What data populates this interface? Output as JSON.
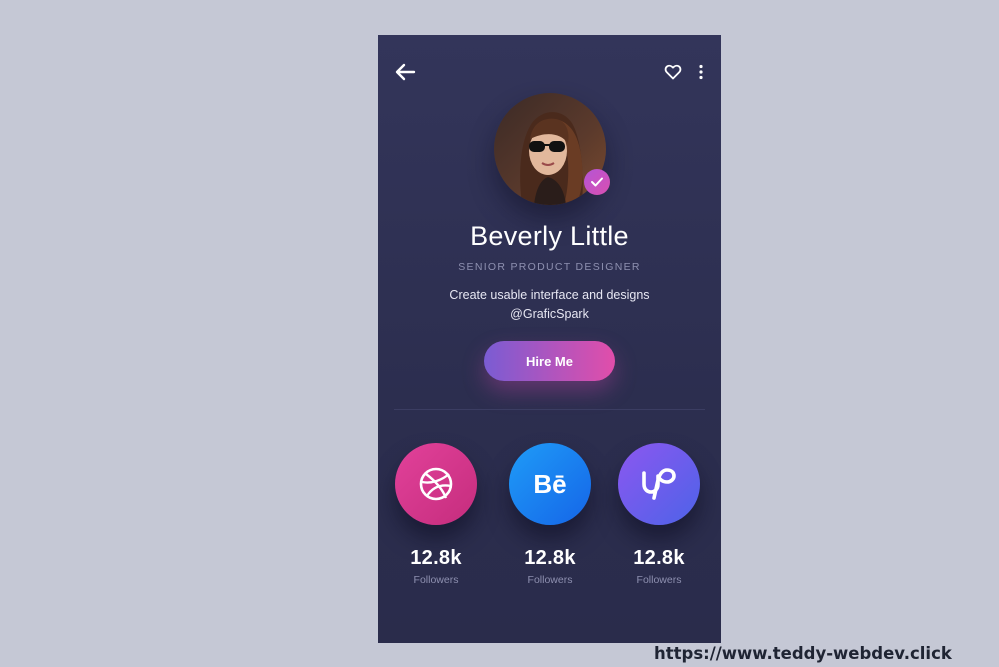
{
  "profile": {
    "name": "Beverly Little",
    "role": "SENIOR PRODUCT DESIGNER",
    "bio": "Create usable interface and designs @GraficSpark",
    "verified": true
  },
  "actions": {
    "hire_label": "Hire Me"
  },
  "stats": [
    {
      "network": "dribbble",
      "icon": "dribbble-icon",
      "count": "12.8k",
      "label": "Followers",
      "color": "#d6358b"
    },
    {
      "network": "behance",
      "icon": "behance-icon",
      "count": "12.8k",
      "label": "Followers",
      "color": "#1a82f0"
    },
    {
      "network": "upwork",
      "icon": "upwork-icon",
      "count": "12.8k",
      "label": "Followers",
      "color": "#6d5cec"
    }
  ],
  "behance_glyph": "Bē",
  "watermark": "https://www.teddy-webdev.click",
  "colors": {
    "page_bg": "#c5c8d5",
    "card_bg": "#2e3052",
    "accent_start": "#7a5cd3",
    "accent_end": "#e14eaa",
    "muted_text": "#8e90b0"
  }
}
